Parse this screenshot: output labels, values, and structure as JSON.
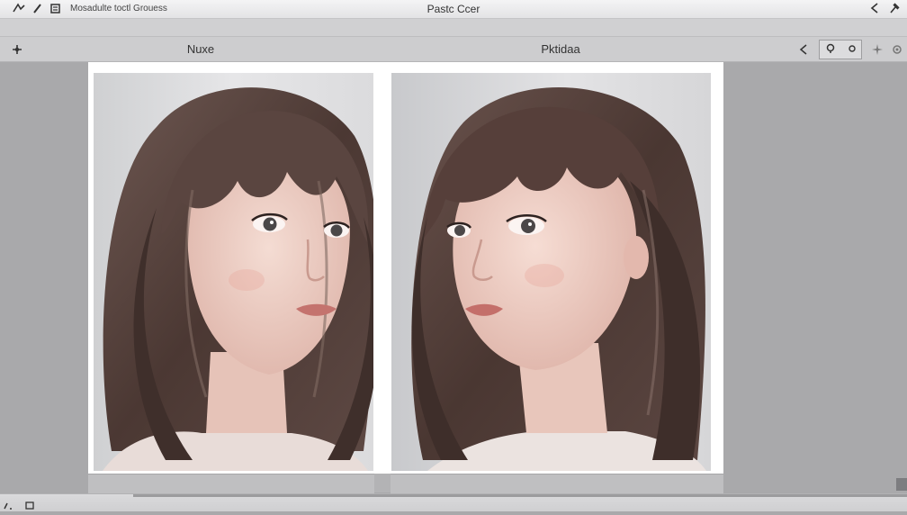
{
  "titlebar": {
    "menu_text": "Mosadulte toctl Grouess",
    "app_title": "Pastc Ccer"
  },
  "viewbar": {
    "left_label": "Nuxe",
    "preview_label": "Pktidaa"
  },
  "icons": {
    "title_left": [
      "pen-icon",
      "brush-icon",
      "document-icon"
    ],
    "title_right": [
      "back-arrow-icon",
      "pin-icon"
    ],
    "view_right": [
      "play-back-icon",
      "zoom-control-icon",
      "sparkle-icon",
      "settings-icon"
    ],
    "bottom": [
      "shape-icon",
      "square-icon"
    ]
  },
  "colors": {
    "background": "#a9a9ab",
    "canvas": "#ffffff",
    "hair": "#5b4540",
    "skin": "#f0d2c9"
  }
}
